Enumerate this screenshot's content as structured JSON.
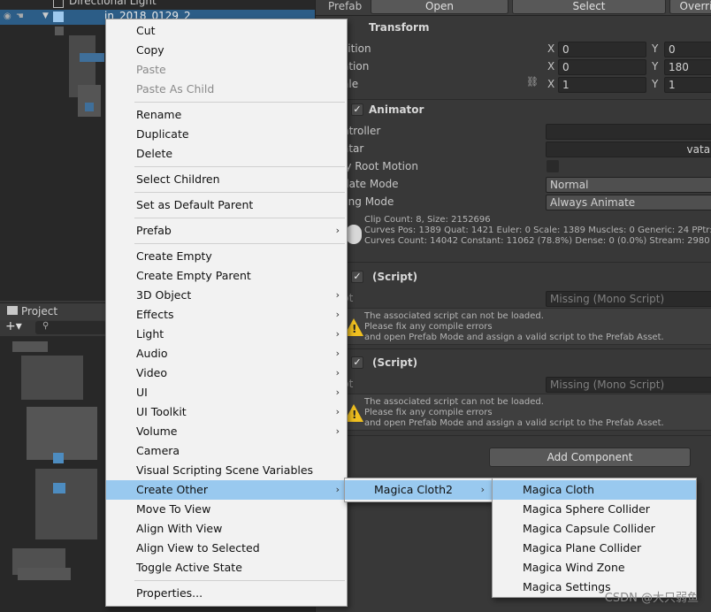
{
  "hierarchy": {
    "items": [
      "Directional Light",
      "in_2018_0129_2"
    ]
  },
  "project": {
    "tab_label": "Project"
  },
  "inspector": {
    "prefab_bar": {
      "label": "Prefab",
      "open": "Open",
      "select": "Select",
      "overrides": "Overri"
    },
    "transform": {
      "title": "Transform",
      "position": {
        "label": "sition",
        "x": "0",
        "y": "0"
      },
      "rotation": {
        "label": "ation",
        "x": "0",
        "y": "180"
      },
      "scale": {
        "label": "ale",
        "x": "1",
        "y": "1"
      }
    },
    "animator": {
      "title": "Animator",
      "controller_label": "ntroller",
      "avatar_label": "atar",
      "avatar_value": "vatar",
      "apply_root_motion_label": "ly Root Motion",
      "update_mode": {
        "label": "date Mode",
        "value": "Normal"
      },
      "culling_mode": {
        "label": "ling Mode",
        "value": "Always Animate"
      },
      "info": [
        "Clip Count: 8, Size: 2152696",
        "Curves Pos: 1389 Quat: 1421 Euler: 0 Scale: 1389 Muscles: 0 Generic: 24 PPtr: 0",
        "Curves Count: 14042 Constant: 11062 (78.8%) Dense: 0 (0.0%) Stream: 2980 (21.2"
      ]
    },
    "scripts": [
      {
        "title": "(Script)",
        "script_label": "pt",
        "script_value": "Missing (Mono Script)",
        "warning": [
          "The associated script can not be loaded.",
          "Please fix any compile errors",
          "and open Prefab Mode and assign a valid script to the Prefab Asset."
        ]
      },
      {
        "title": "(Script)",
        "script_label": "pt",
        "script_value": "Missing (Mono Script)",
        "warning": [
          "The associated script can not be loaded.",
          "Please fix any compile errors",
          "and open Prefab Mode and assign a valid script to the Prefab Asset."
        ]
      }
    ],
    "add_component": "Add Component"
  },
  "context_menu": {
    "items": [
      {
        "label": "Cut"
      },
      {
        "label": "Copy"
      },
      {
        "label": "Paste",
        "disabled": true
      },
      {
        "label": "Paste As Child",
        "disabled": true
      },
      {
        "separator": true
      },
      {
        "label": "Rename"
      },
      {
        "label": "Duplicate"
      },
      {
        "label": "Delete"
      },
      {
        "separator": true
      },
      {
        "label": "Select Children"
      },
      {
        "separator": true
      },
      {
        "label": "Set as Default Parent"
      },
      {
        "separator": true
      },
      {
        "label": "Prefab",
        "submenu": true
      },
      {
        "separator": true
      },
      {
        "label": "Create Empty"
      },
      {
        "label": "Create Empty Parent"
      },
      {
        "label": "3D Object",
        "submenu": true
      },
      {
        "label": "Effects",
        "submenu": true
      },
      {
        "label": "Light",
        "submenu": true
      },
      {
        "label": "Audio",
        "submenu": true
      },
      {
        "label": "Video",
        "submenu": true
      },
      {
        "label": "UI",
        "submenu": true
      },
      {
        "label": "UI Toolkit",
        "submenu": true
      },
      {
        "label": "Volume",
        "submenu": true
      },
      {
        "label": "Camera"
      },
      {
        "label": "Visual Scripting Scene Variables"
      },
      {
        "label": "Create Other",
        "submenu": true,
        "highlighted": true
      },
      {
        "label": "Move To View"
      },
      {
        "label": "Align With View"
      },
      {
        "label": "Align View to Selected"
      },
      {
        "label": "Toggle Active State"
      },
      {
        "separator": true
      },
      {
        "label": "Properties..."
      }
    ]
  },
  "submenu_create_other": {
    "items": [
      {
        "label": "Magica Cloth2",
        "submenu": true,
        "highlighted": true
      }
    ]
  },
  "submenu_magica": {
    "items": [
      {
        "label": "Magica Cloth",
        "highlighted": true
      },
      {
        "label": "Magica Sphere Collider"
      },
      {
        "label": "Magica Capsule Collider"
      },
      {
        "label": "Magica Plane Collider"
      },
      {
        "label": "Magica Wind Zone"
      },
      {
        "label": "Magica Settings"
      }
    ]
  },
  "watermark": "CSDN @大只弱鱼"
}
